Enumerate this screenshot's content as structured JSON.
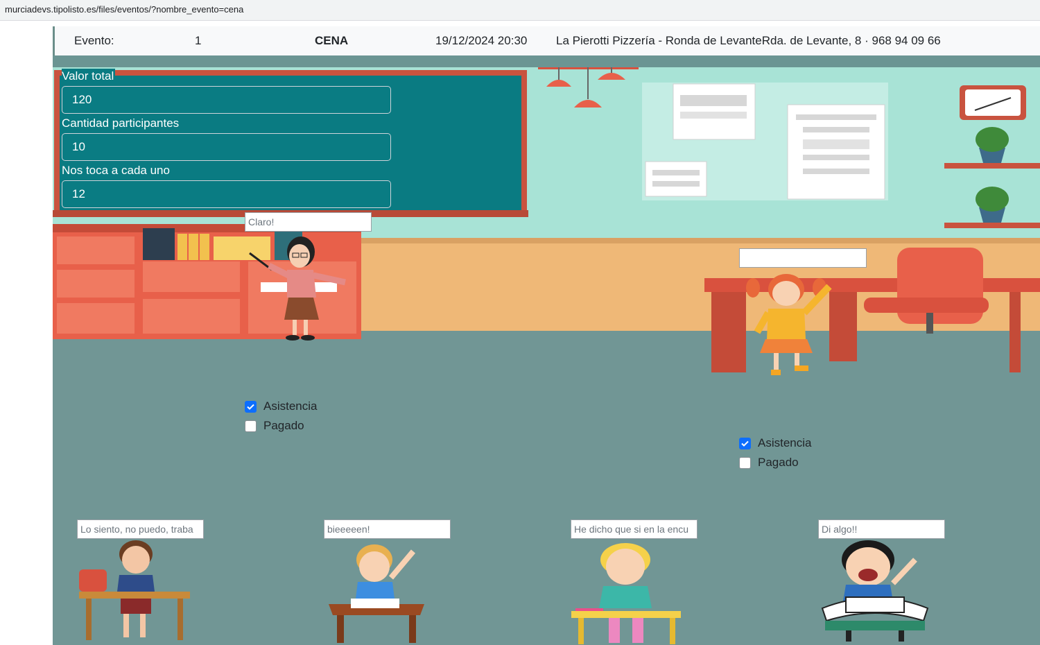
{
  "browser": {
    "url": "murciadevs.tipolisto.es/files/eventos/?nombre_evento=cena"
  },
  "event": {
    "label": "Evento:",
    "id": "1",
    "name": "CENA",
    "datetime": "19/12/2024 20:30",
    "place": "La Pierotti Pizzería - Ronda de LevanteRda. de Levante, 8 · 968 94 09 66"
  },
  "form": {
    "total_label": "Valor total",
    "total_value": "120",
    "participants_label": "Cantidad participantes",
    "participants_value": "10",
    "per_person_label": "Nos toca a cada uno",
    "per_person_value": "12"
  },
  "participants": {
    "teacher": {
      "message": "Claro!",
      "attendance_label": "Asistencia",
      "attendance": true,
      "paid_label": "Pagado",
      "paid": false
    },
    "girl": {
      "message": "",
      "attendance_label": "Asistencia",
      "attendance": true,
      "paid_label": "Pagado",
      "paid": false
    },
    "boy1": {
      "message": "Lo siento, no puedo, traba"
    },
    "boy2": {
      "message": "bieeeeen!"
    },
    "boy3": {
      "message": "He dicho que si en la encu"
    },
    "boy4": {
      "message": "Di algo!!"
    }
  },
  "colors": {
    "wall": "#a8e3d6",
    "floor": "#719695",
    "board": "#0a7b82",
    "board_frame": "#c9533f",
    "cabinet": "#e8604a",
    "desk": "#d9513e",
    "checkbox": "#0d6efd"
  }
}
